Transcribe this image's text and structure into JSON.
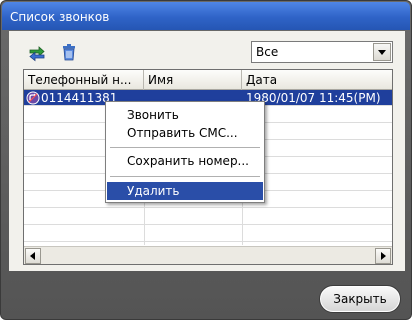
{
  "window": {
    "title": "Список звонков"
  },
  "toolbar": {
    "icons": [
      "swap-arrows-icon",
      "trash-icon"
    ]
  },
  "filter": {
    "selected": "Все"
  },
  "table": {
    "columns": [
      "Телефонный н...",
      "Имя",
      "Дата"
    ],
    "rows": [
      {
        "phone": "0114411381",
        "name": "",
        "date": "1980/01/07 11:45(PM)",
        "selected": true
      }
    ]
  },
  "context_menu": {
    "items": [
      "Звонить",
      "Отправить СМС...",
      "Сохранить номер...",
      "Удалить"
    ],
    "active_index": 3
  },
  "footer": {
    "close_label": "Закрыть"
  },
  "colors": {
    "title_bar": "#2f63c7",
    "selection": "#1f3f9c",
    "menu_highlight": "#2a4ea8",
    "frame": "#545454"
  }
}
